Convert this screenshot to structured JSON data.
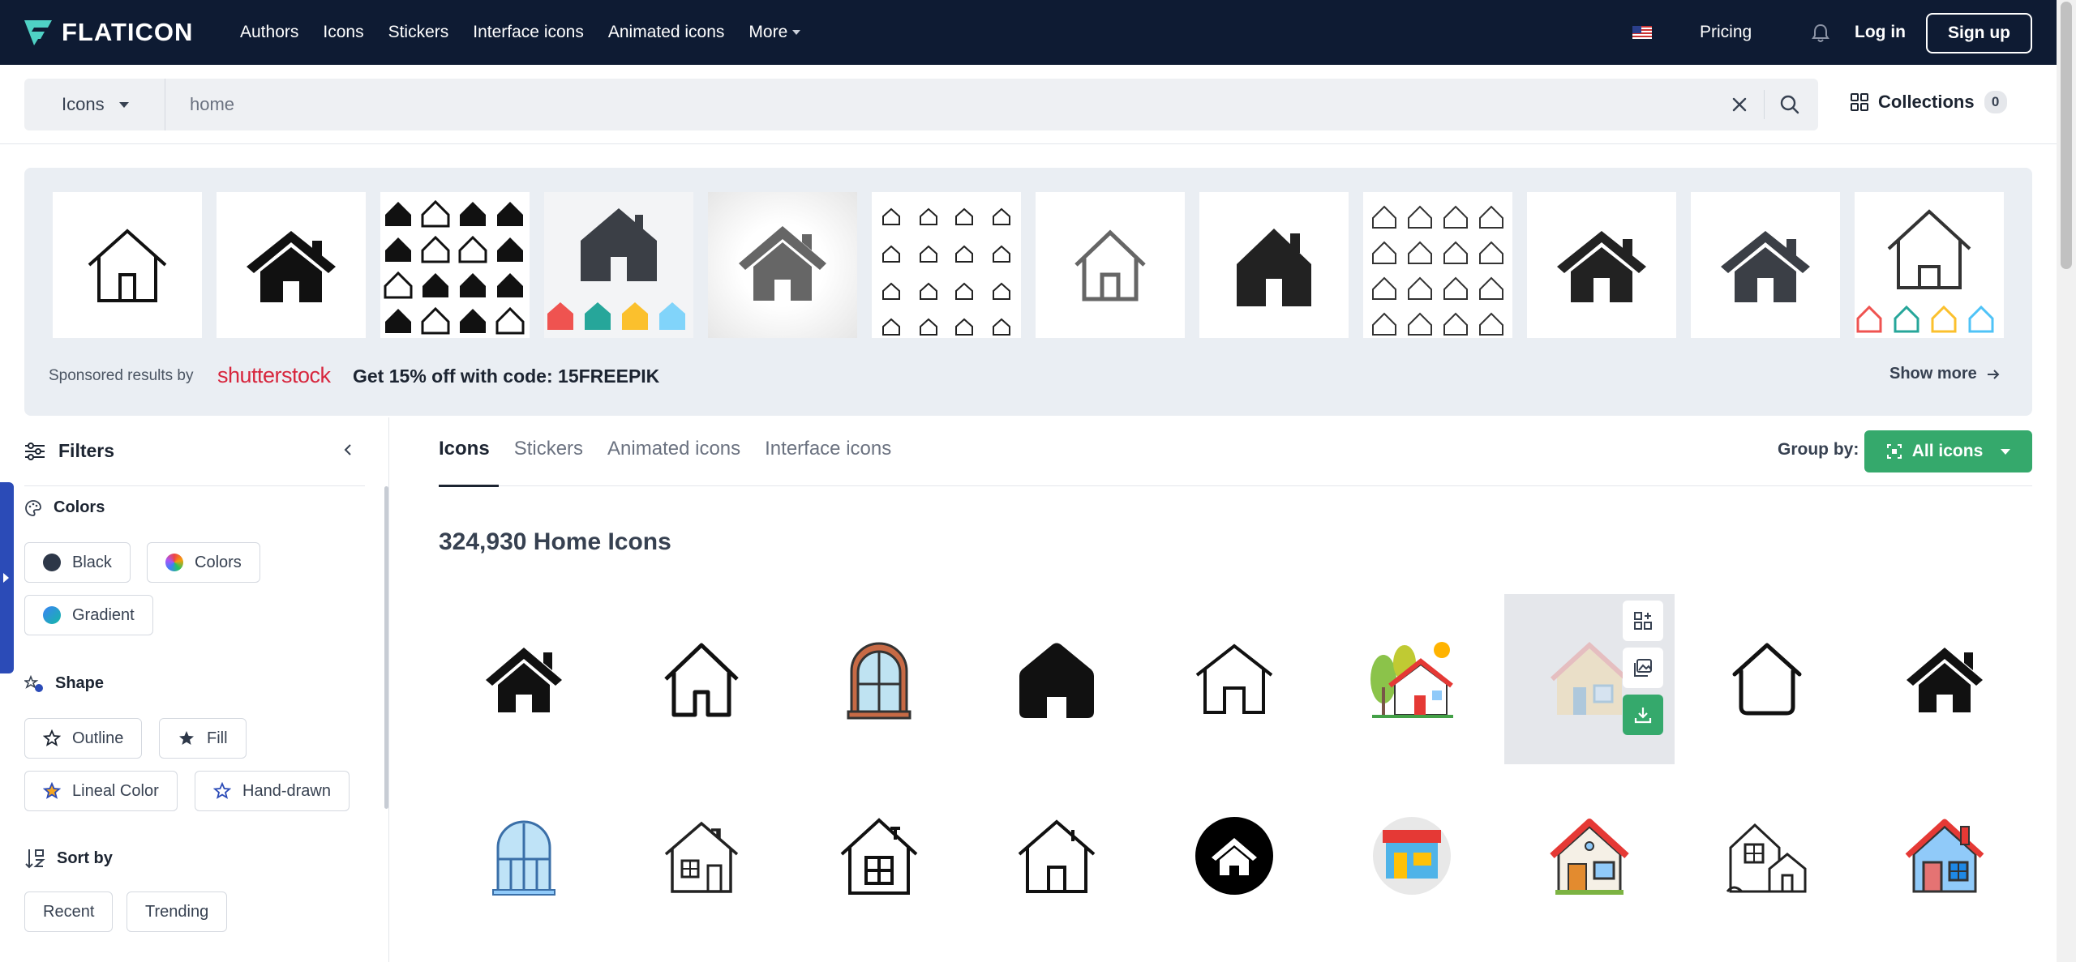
{
  "header": {
    "logo_text": "FLATICON",
    "nav": [
      "Authors",
      "Icons",
      "Stickers",
      "Interface icons",
      "Animated icons"
    ],
    "more_label": "More",
    "pricing": "Pricing",
    "login": "Log in",
    "signup": "Sign up"
  },
  "search": {
    "type": "Icons",
    "query": "home",
    "collections_label": "Collections",
    "collections_count": "0"
  },
  "sponsored": {
    "label": "Sponsored results by",
    "brand": "shutterstock",
    "promo": "Get 15% off with code: 15FREEPIK",
    "show_more": "Show more"
  },
  "filters": {
    "title": "Filters",
    "colors": {
      "title": "Colors",
      "options": [
        "Black",
        "Colors",
        "Gradient"
      ]
    },
    "shape": {
      "title": "Shape",
      "options": [
        "Outline",
        "Fill",
        "Lineal Color",
        "Hand-drawn"
      ]
    },
    "sort": {
      "title": "Sort by",
      "options": [
        "Recent",
        "Trending"
      ]
    }
  },
  "results": {
    "tabs": [
      "Icons",
      "Stickers",
      "Animated icons",
      "Interface icons"
    ],
    "active_tab": "Icons",
    "group_by_label": "Group by:",
    "group_by_value": "All icons",
    "count_title": "324,930 Home Icons"
  },
  "colors": {
    "header_bg": "#0e1b33",
    "accent_green": "#35a96c",
    "sponsored_bg": "#eaeef3",
    "shutterstock_red": "#d7263d"
  }
}
